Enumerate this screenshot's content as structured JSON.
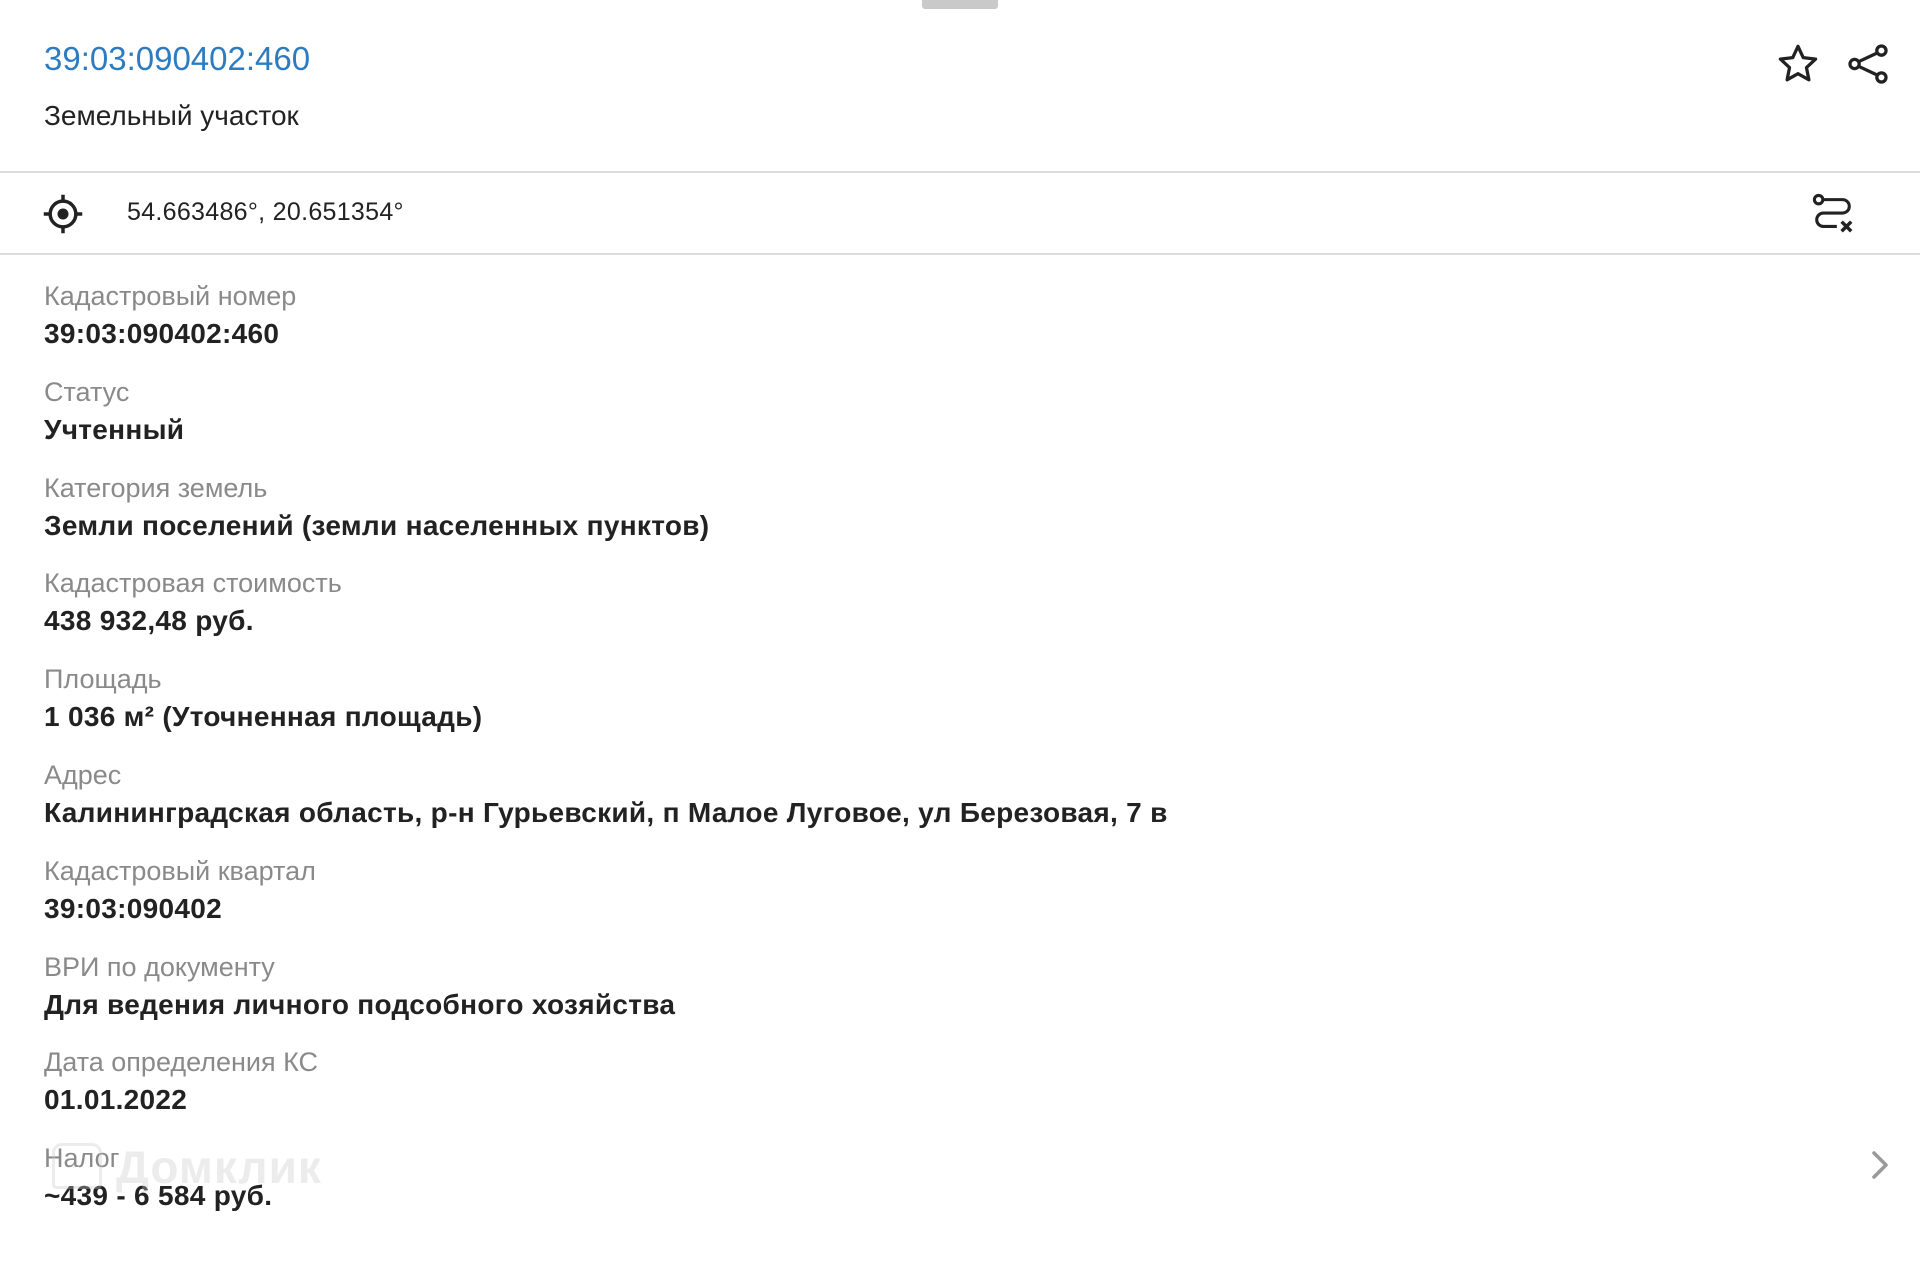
{
  "header": {
    "title": "39:03:090402:460",
    "subtitle": "Земельный участок",
    "favorite_icon": "star-icon",
    "share_icon": "share-icon"
  },
  "location": {
    "coordinates": "54.663486°, 20.651354°",
    "locate_icon": "crosshair-icon",
    "route_icon": "route-cancel-icon"
  },
  "fields": [
    {
      "label": "Кадастровый номер",
      "value": "39:03:090402:460"
    },
    {
      "label": "Статус",
      "value": "Учтенный"
    },
    {
      "label": "Категория земель",
      "value": "Земли поселений (земли населенных пунктов)"
    },
    {
      "label": "Кадастровая стоимость",
      "value": "438 932,48 руб."
    },
    {
      "label": "Площадь",
      "value": "1 036 м² (Уточненная площадь)"
    },
    {
      "label": "Адрес",
      "value": "Калининградская область, р-н Гурьевский, п Малое Луговое, ул Березовая, 7 в"
    },
    {
      "label": "Кадастровый квартал",
      "value": "39:03:090402"
    },
    {
      "label": "ВРИ по документу",
      "value": "Для ведения личного подсобного хозяйства"
    },
    {
      "label": "Дата определения КС",
      "value": "01.01.2022"
    },
    {
      "label": "Налог",
      "value": "~439 - 6 584 руб."
    }
  ],
  "watermark": "Домклик",
  "colors": {
    "link": "#2d7cc0",
    "label": "#8a8a8a",
    "value": "#222222",
    "divider": "#dcdcdc"
  }
}
